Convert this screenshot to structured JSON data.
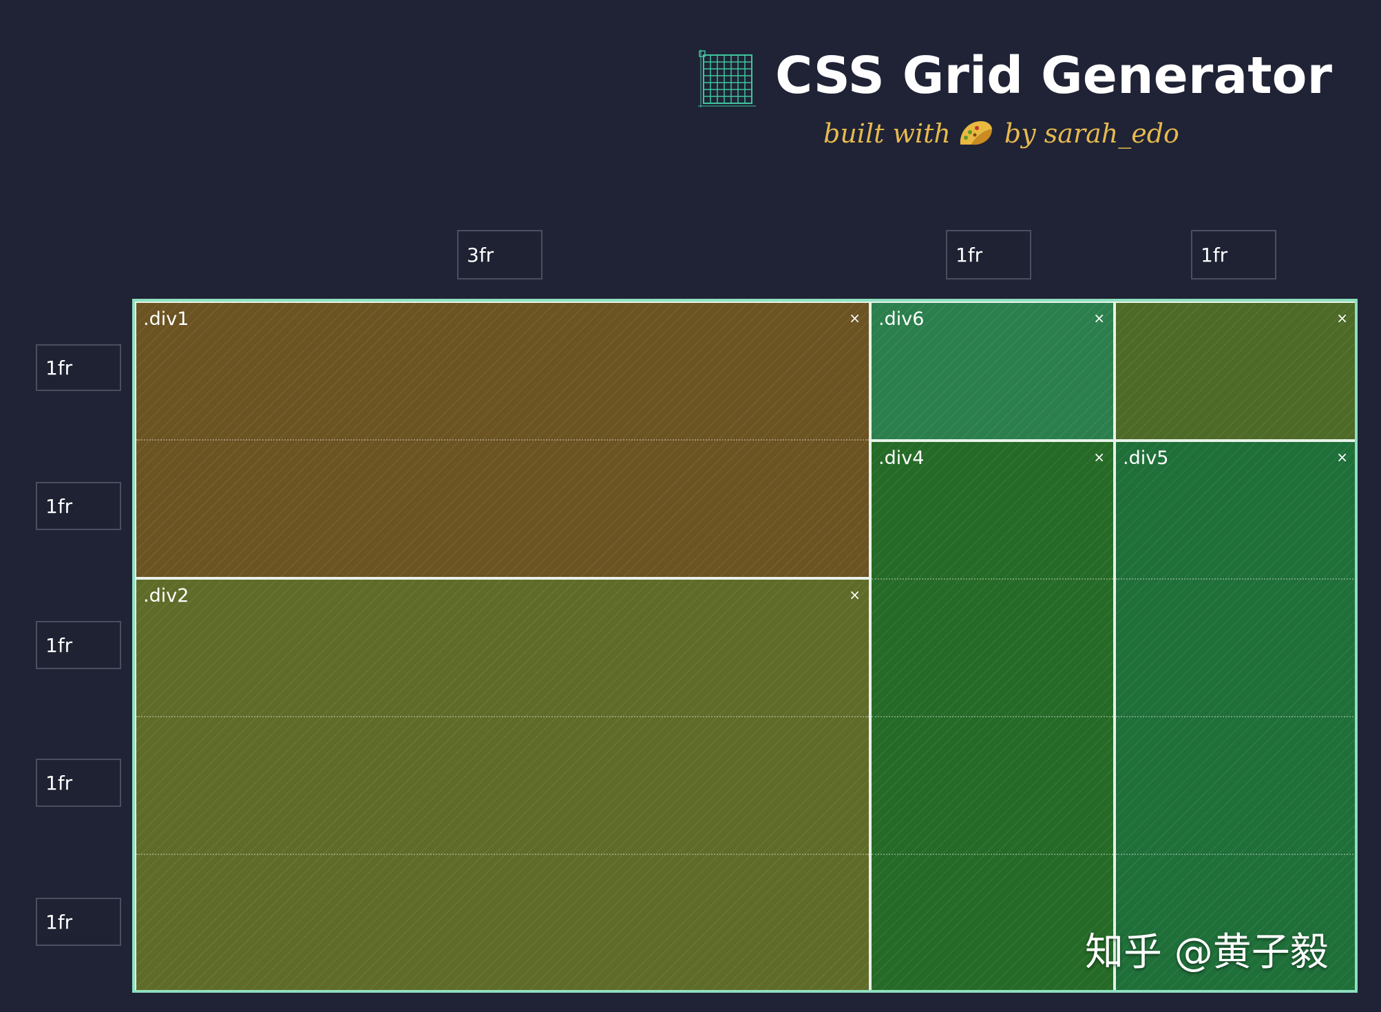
{
  "app": {
    "title": "CSS Grid Generator",
    "subtitle_before": "built with",
    "subtitle_after": "by sarah_edo"
  },
  "colors": {
    "background": "#1f2335",
    "grid_border": "#8ee0c0",
    "subtitle": "#e7b94f",
    "div1_brown": "#6b5322",
    "div2_olive": "#5f6b28",
    "div6_green": "#2b7f4c",
    "empty_cell_green": "#4d6a26",
    "div4_green": "#256a26",
    "div5_green": "#1f6f39"
  },
  "icons": {
    "header": "grid-icon",
    "subtitle": "taco-icon",
    "close": "close-icon"
  },
  "columns": [
    {
      "value": "3fr"
    },
    {
      "value": "1fr"
    },
    {
      "value": "1fr"
    }
  ],
  "rows": [
    {
      "value": "1fr"
    },
    {
      "value": "1fr"
    },
    {
      "value": "1fr"
    },
    {
      "value": "1fr"
    },
    {
      "value": "1fr"
    }
  ],
  "areas": {
    "div1": {
      "label": ".div1",
      "close": "×"
    },
    "div2": {
      "label": ".div2",
      "close": "×"
    },
    "div6": {
      "label": ".div6",
      "close": "×"
    },
    "empty": {
      "label": "",
      "close": "×"
    },
    "div4": {
      "label": ".div4",
      "close": "×"
    },
    "div5": {
      "label": ".div5",
      "close": "×"
    }
  },
  "watermark": "知乎 @黄子毅"
}
